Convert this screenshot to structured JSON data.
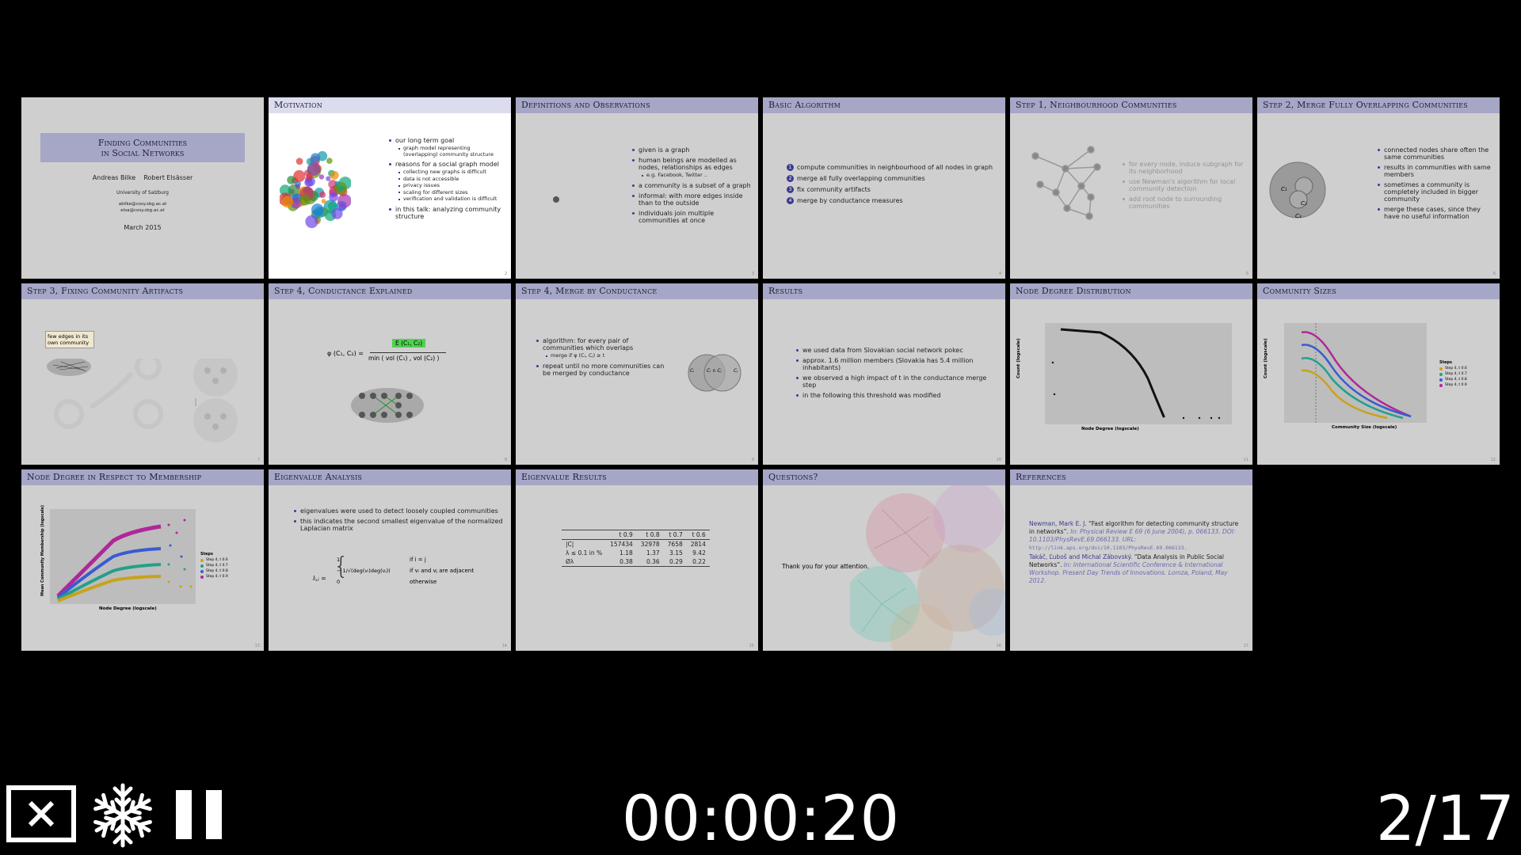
{
  "slides": [
    {
      "number": "1",
      "title_line1": "Finding Communities",
      "title_line2": "in Social Networks",
      "authors": "Andreas Bilke    Robert Elsässer",
      "affiliation": "University of Salzburg",
      "email1": "abilke@cosy.sbg.ac.at",
      "email2": "elsa@cosy.sbg.ac.at",
      "date": "March 2015"
    },
    {
      "number": "2",
      "title": "Motivation",
      "bullets": [
        {
          "text": "our long term goal",
          "sub": [
            "graph model representing (overlapping) community structure"
          ]
        },
        {
          "text": "reasons for a social graph model",
          "sub": [
            "collecting new graphs is difficult",
            "data is not accessible",
            "privacy issues",
            "scaling for different sizes",
            "verification and validation is difficult"
          ]
        },
        {
          "text": "in this talk: analyzing community structure",
          "sub": []
        }
      ]
    },
    {
      "number": "3",
      "title": "Definitions and Observations",
      "bullets": [
        {
          "text": "given is a graph",
          "sub": []
        },
        {
          "text": "human beings are modelled as nodes, relationships as edges",
          "sub": [
            "e.g. Facebook, Twitter .."
          ]
        },
        {
          "text": "a community is a subset of a graph",
          "sub": []
        },
        {
          "text": "informal: with more edges inside than to the outside",
          "sub": []
        },
        {
          "text": "individuals join multiple communities at once",
          "sub": []
        }
      ]
    },
    {
      "number": "4",
      "title": "Basic Algorithm",
      "steps": [
        "compute communities in neighbourhood of all nodes in graph",
        "merge all fully overlapping communities",
        "fix community artifacts",
        "merge by conductance measures"
      ]
    },
    {
      "number": "5",
      "title": "Step 1, Neighbourhood Communities",
      "bullets": [
        "for every node, induce subgraph for its neighborhood",
        "use Newman's algorithm for local community detection",
        "add root node to surrounding communities"
      ]
    },
    {
      "number": "6",
      "title": "Step 2, Merge Fully Overlapping Communities",
      "labels": [
        "C₁",
        "C₂",
        "C₃"
      ],
      "bullets": [
        "connected nodes share often the same communities",
        "results in communities with same members",
        "sometimes a community is completely included in bigger community",
        "merge these cases, since they have no useful information"
      ]
    },
    {
      "number": "7",
      "title": "Step 3, Fixing Community Artifacts",
      "callout": "few edges in its own community"
    },
    {
      "number": "8",
      "title": "Step 4, Conductance Explained",
      "phi": "φ (C₁, C₂) =",
      "numerator": "E (C₁, C₂)",
      "denominator": "min ( vol (C₁) , vol (C₂) )"
    },
    {
      "number": "9",
      "title": "Step 4, Merge by Conductance",
      "bullets": [
        {
          "text": "algorithm: for every pair of communities which overlaps",
          "sub": [
            "merge if φ (Cᵢ, Cⱼ) ≥ t"
          ]
        },
        {
          "text": "repeat until no more communities can be merged by conductance",
          "sub": []
        }
      ],
      "venn": [
        "Cᵢ",
        "Cᵢ ∩ Cⱼ",
        "Cⱼ"
      ]
    },
    {
      "number": "10",
      "title": "Results",
      "bullets": [
        "we used data from Slovakian social network pokec",
        "approx. 1.6 million members (Slovakia has 5.4 million inhabitants)",
        "we observed a high impact of t in the conductance merge step",
        "in the following this threshold was modified"
      ]
    },
    {
      "number": "11",
      "title": "Node Degree Distribution",
      "xlabel": "Node Degree (logscale)",
      "ylabel": "Count (logscale)"
    },
    {
      "number": "12",
      "title": "Community Sizes",
      "xlabel": "Community Size (logscale)",
      "ylabel": "Count (logscale)",
      "legend_title": "Steps",
      "legend": [
        "Step 4, t 0.6",
        "Step 4, t 0.7",
        "Step 4, t 0.8",
        "Step 4, t 0.9"
      ]
    },
    {
      "number": "13",
      "title": "Node Degree in Respect to Membership",
      "xlabel": "Node Degree (logscale)",
      "ylabel": "Mean Community Membership (logscale)",
      "legend_title": "Steps",
      "legend": [
        "Step 4, t 0.6",
        "Step 4, t 0.7",
        "Step 4, t 0.8",
        "Step 4, t 0.9"
      ]
    },
    {
      "number": "14",
      "title": "Eigenvalue Analysis",
      "bullets": [
        "eigenvalues were used to detect loosely coupled communities",
        "this indicates the second smallest eigenvalue of the normalized Laplacian matrix"
      ],
      "formula_lhs": "lᵢ,ⱼ =",
      "cases": [
        [
          "1",
          "if i = j"
        ],
        [
          "− 1/√(deg(vᵢ)deg(vⱼ))",
          "if vᵢ and vⱼ are adjacent"
        ],
        [
          "0",
          "otherwise"
        ]
      ]
    },
    {
      "number": "15",
      "title": "Eigenvalue Results",
      "columns": [
        "",
        "t 0.9",
        "t 0.8",
        "t 0.7",
        "t 0.6"
      ],
      "rows": [
        [
          "|C|",
          "157434",
          "32978",
          "7658",
          "2814"
        ],
        [
          "λ ≤ 0.1 in %",
          "1.18",
          "1.37",
          "3.15",
          "9.42"
        ],
        [
          "Øλ",
          "0.38",
          "0.36",
          "0.29",
          "0.22"
        ]
      ]
    },
    {
      "number": "16",
      "title": "Questions?",
      "text": "Thank you for your attention."
    },
    {
      "number": "17",
      "title": "References",
      "refs": [
        {
          "author": "Newman, Mark E. J.",
          "title": "“Fast algorithm for detecting community structure in networks”.",
          "venue": "In: Physical Review E 69 (6 June 2004), p. 066133. DOI: 10.1103/PhysRevE.69.066133. URL:",
          "url": "http://link.aps.org/doi/10.1103/PhysRevE.69.066133."
        },
        {
          "author": "Takáč, Ľuboš and Michal Zábovský.",
          "title": "“Data Analysis in Public Social Networks”.",
          "venue": "In: International Scientific Conference & International Workshop. Present Day Trends of Innovations. Lomza, Poland, May 2012.",
          "url": ""
        }
      ]
    }
  ],
  "controls": {
    "exit_icon": "close-box-icon",
    "freeze_icon": "snowflake-icon",
    "pause_icon": "pause-icon",
    "timer": "00:00:20",
    "counter": "2/17"
  },
  "colors": {
    "header": "#a6a6c6",
    "accent": "#3b3b8f",
    "background": "#000000"
  }
}
